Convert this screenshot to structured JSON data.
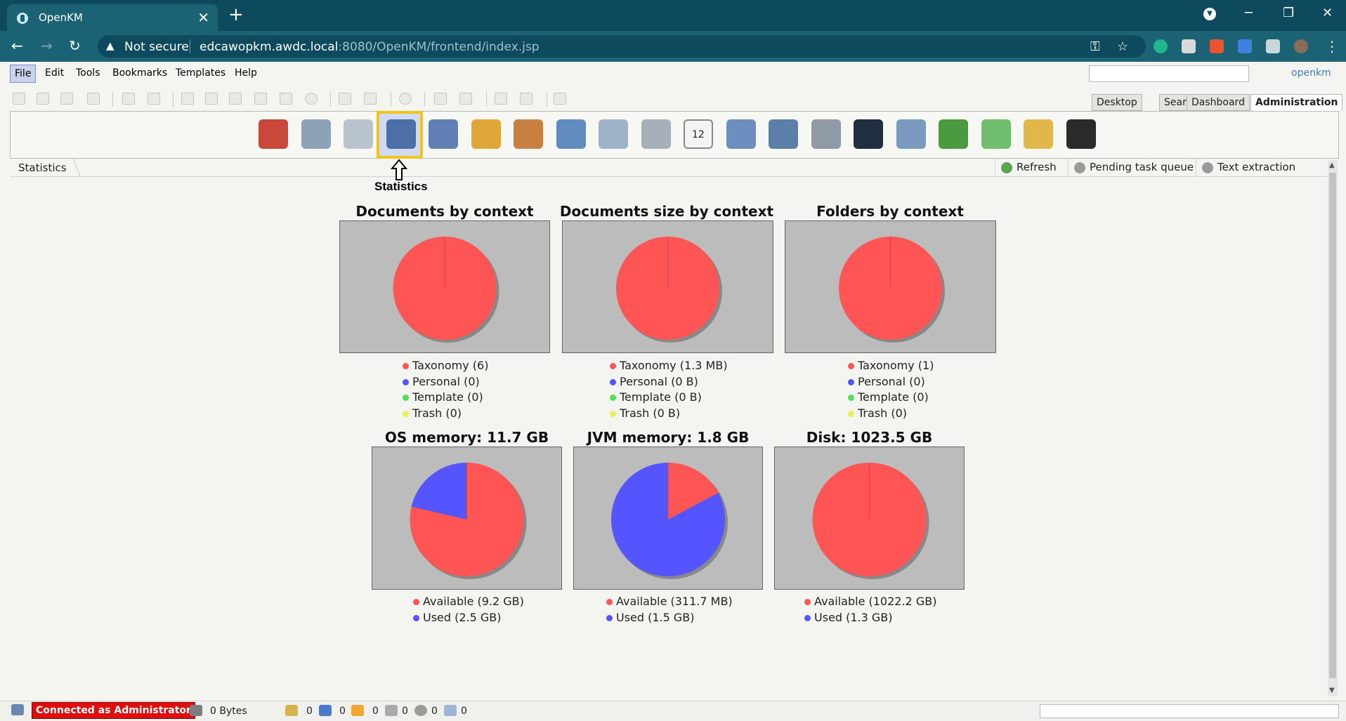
{
  "browser": {
    "tab_title": "OpenKM",
    "not_secure": "Not secure",
    "url_host": "edcawopkm.awdc.local",
    "url_rest": ":8080/OpenKM/frontend/index.jsp"
  },
  "menu": {
    "items": [
      "File",
      "Edit",
      "Tools",
      "Bookmarks",
      "Templates",
      "Help"
    ],
    "brand": "openkm"
  },
  "perspective_tabs": [
    "Desktop",
    "Search",
    "Dashboard",
    "Administration"
  ],
  "admin_icons": [
    "home-icon",
    "tools-icon",
    "search-doc-icon",
    "statistics-icon",
    "diamond-icon",
    "scissors-icon",
    "users-icon",
    "database-icon",
    "magnify-doc-icon",
    "scanner-icon",
    "calendar-icon",
    "gear-icon",
    "report-icon",
    "clock-icon",
    "list-icon",
    "pen-icon",
    "stack-icon",
    "import-icon",
    "export-icon",
    "terminal-icon"
  ],
  "calendar_number": "12",
  "breadcrumb": "Statistics",
  "buttons": {
    "refresh": "Refresh",
    "pending": "Pending task queue",
    "extraction": "Text extraction queue"
  },
  "annotation": "Statistics",
  "colors": {
    "red": "#ff5555",
    "blue": "#5555ff",
    "green": "#55dd55",
    "yellow": "#eeee55",
    "selection": "#f1c31b",
    "connected": "#e00d0d"
  },
  "charts": {
    "docs": {
      "title": "Documents by context",
      "legend": [
        "Taxonomy (6)",
        "Personal (0)",
        "Template (0)",
        "Trash (0)"
      ]
    },
    "size": {
      "title": "Documents size by context",
      "legend": [
        "Taxonomy (1.3 MB)",
        "Personal (0 B)",
        "Template (0 B)",
        "Trash (0 B)"
      ]
    },
    "folders": {
      "title": "Folders by context",
      "legend": [
        "Taxonomy (1)",
        "Personal (0)",
        "Template (0)",
        "Trash (0)"
      ]
    },
    "os": {
      "title": "OS memory: 11.7 GB",
      "legend": [
        "Available (9.2 GB)",
        "Used (2.5 GB)"
      ]
    },
    "jvm": {
      "title": "JVM memory: 1.8 GB",
      "legend": [
        "Available (311.7 MB)",
        "Used (1.5 GB)"
      ]
    },
    "disk": {
      "title": "Disk: 1023.5 GB",
      "legend": [
        "Available (1022.2 GB)",
        "Used (1.3 GB)"
      ]
    }
  },
  "chart_data": [
    {
      "type": "pie",
      "title": "Documents by context",
      "labels": [
        "Taxonomy",
        "Personal",
        "Template",
        "Trash"
      ],
      "values": [
        6,
        0,
        0,
        0
      ]
    },
    {
      "type": "pie",
      "title": "Documents size by context",
      "labels": [
        "Taxonomy",
        "Personal",
        "Template",
        "Trash"
      ],
      "values": [
        1.3,
        0,
        0,
        0
      ],
      "unit": "MB"
    },
    {
      "type": "pie",
      "title": "Folders by context",
      "labels": [
        "Taxonomy",
        "Personal",
        "Template",
        "Trash"
      ],
      "values": [
        1,
        0,
        0,
        0
      ]
    },
    {
      "type": "pie",
      "title": "OS memory: 11.7 GB",
      "labels": [
        "Available",
        "Used"
      ],
      "values": [
        9.2,
        2.5
      ],
      "unit": "GB"
    },
    {
      "type": "pie",
      "title": "JVM memory: 1.8 GB",
      "labels": [
        "Available",
        "Used"
      ],
      "values": [
        0.3117,
        1.5
      ],
      "unit": "GB"
    },
    {
      "type": "pie",
      "title": "Disk: 1023.5 GB",
      "labels": [
        "Available",
        "Used"
      ],
      "values": [
        1022.2,
        1.3
      ],
      "unit": "GB"
    }
  ],
  "status": {
    "connected": "Connected as Administrator",
    "size": "0 Bytes",
    "counts": [
      "0",
      "0",
      "0",
      "0",
      "0",
      "0"
    ]
  }
}
